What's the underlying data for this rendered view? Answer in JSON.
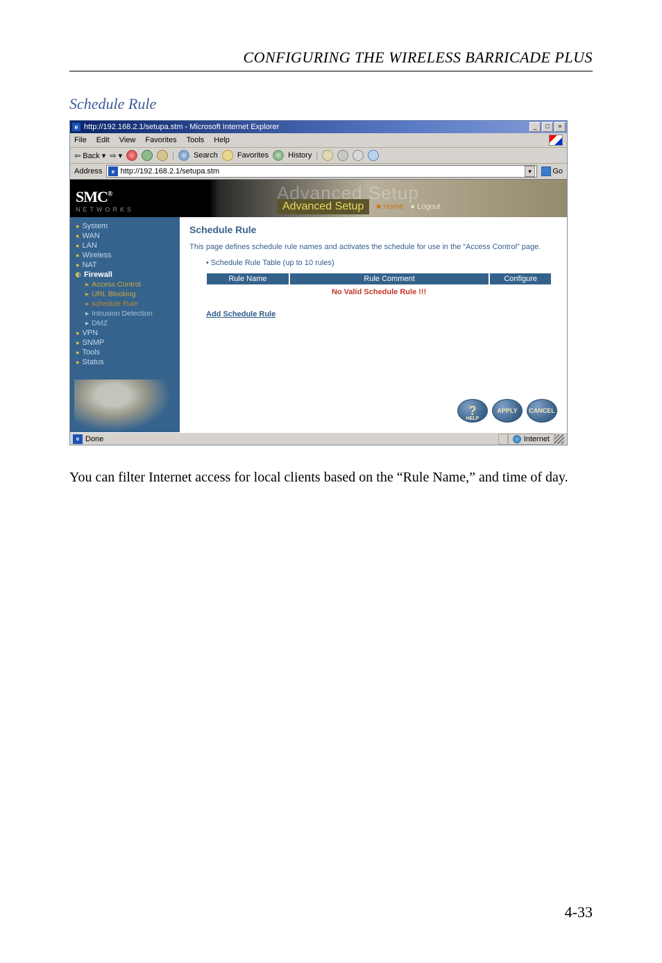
{
  "doc": {
    "header_title": "CONFIGURING THE WIRELESS BARRICADE PLUS",
    "subheading": "Schedule Rule",
    "body_text": "You can filter Internet access for local clients based on the “Rule Name,” and time of day.",
    "page_number": "4-33"
  },
  "window": {
    "title": "http://192.168.2.1/setupa.stm - Microsoft Internet Explorer",
    "min": "_",
    "max": "□",
    "close": "×"
  },
  "menu": {
    "file": "File",
    "edit": "Edit",
    "view": "View",
    "favorites": "Favorites",
    "tools": "Tools",
    "help": "Help"
  },
  "toolbar": {
    "back": "Back",
    "search": "Search",
    "favorites": "Favorites",
    "history": "History"
  },
  "address": {
    "label": "Address",
    "value": "http://192.168.2.1/setupa.stm",
    "go": "Go"
  },
  "banner": {
    "logo": "SMC",
    "reg": "®",
    "networks": "Networks",
    "ghost": "Advanced Setup",
    "box": "Advanced Setup",
    "home": "Home",
    "logout": "Logout"
  },
  "sidebar": {
    "system": "System",
    "wan": "WAN",
    "lan": "LAN",
    "wireless": "Wireless",
    "nat": "NAT",
    "firewall": "Firewall",
    "access_control": "Access Control",
    "url_blocking": "URL Blocking",
    "schedule_rule": "schedule Rule",
    "intrusion": "Intrusion Detection",
    "dmz": "DMZ",
    "vpn": "VPN",
    "snmp": "SNMP",
    "tools": "Tools",
    "status": "Status"
  },
  "main": {
    "title": "Schedule Rule",
    "desc": "This page defines schedule rule names and activates the schedule for use in the “Access Control” page.",
    "table_label": "•  Schedule Rule Table (up to 10 rules)",
    "col_name": "Rule Name",
    "col_comment": "Rule Comment",
    "col_configure": "Configure",
    "no_valid": "No Valid Schedule Rule !!!",
    "add_link": "Add Schedule Rule",
    "help": "?",
    "help_label": "HELP",
    "apply": "APPLY",
    "cancel": "CANCEL"
  },
  "status": {
    "done": "Done",
    "zone": "Internet"
  }
}
